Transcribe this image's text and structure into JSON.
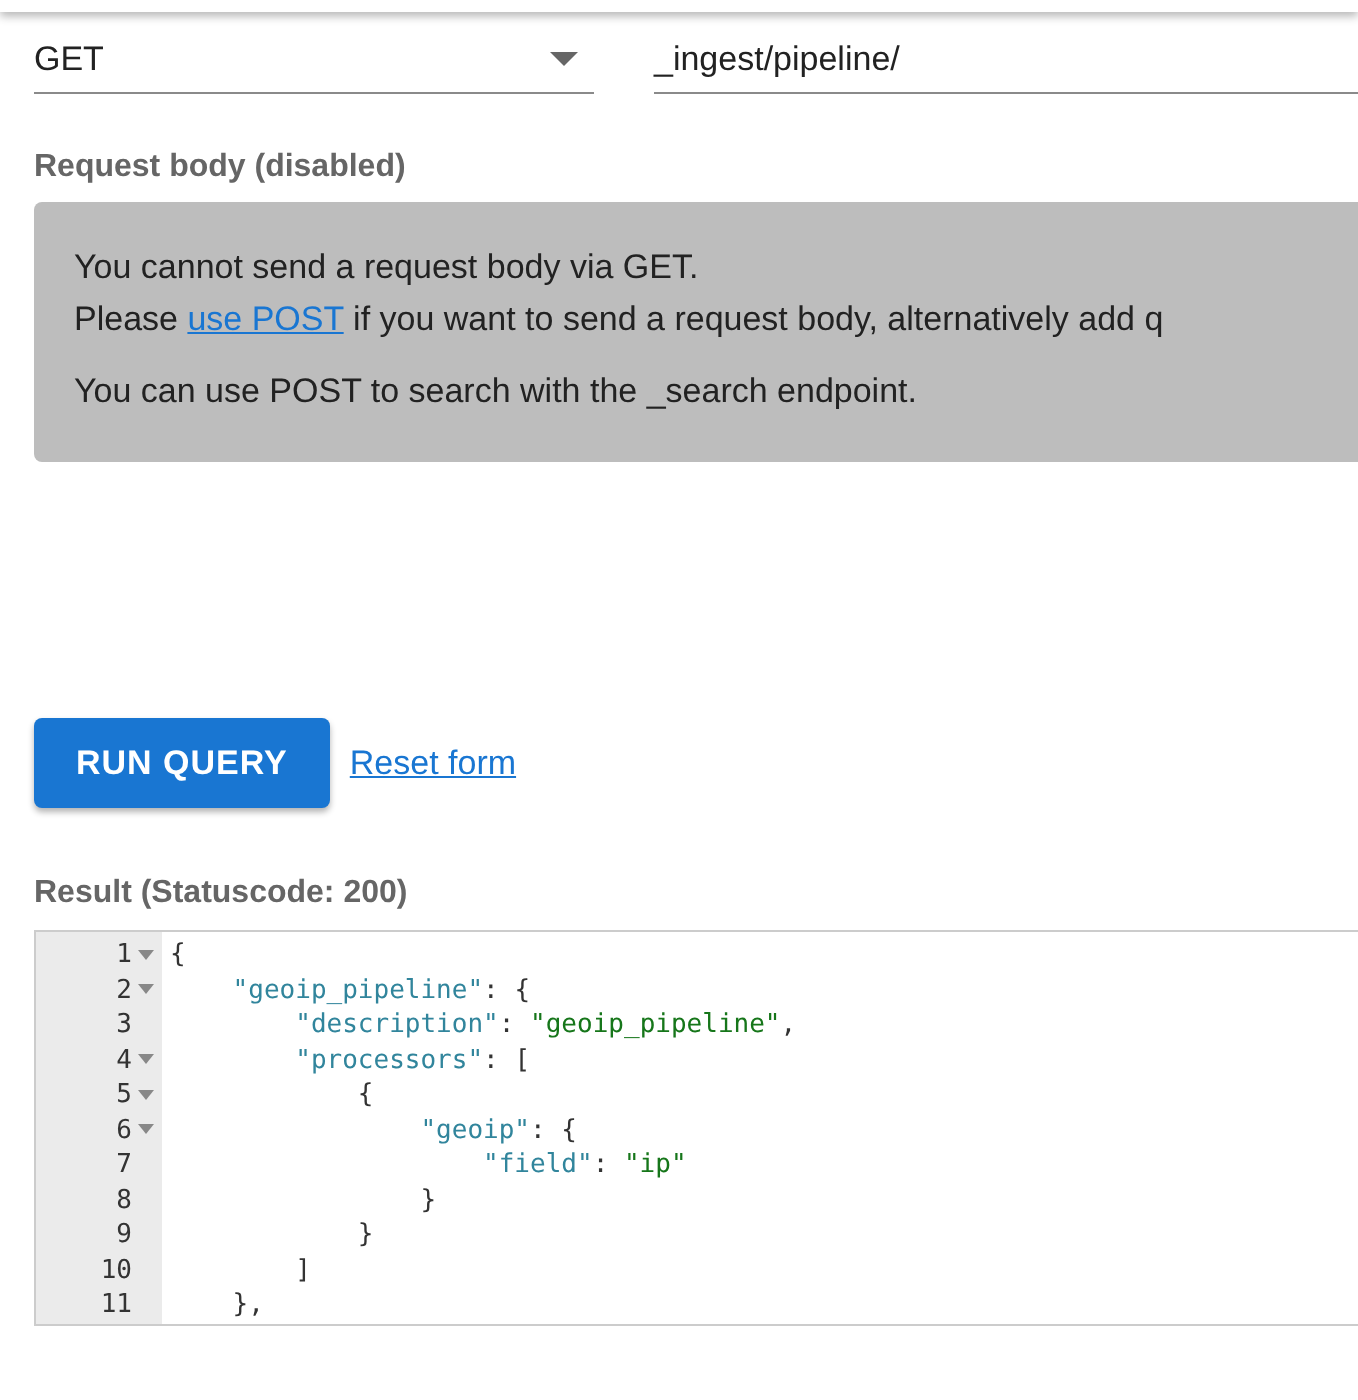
{
  "method_field": {
    "value": "GET"
  },
  "path_field": {
    "value": "_ingest/pipeline/"
  },
  "request_body": {
    "label": "Request body (disabled)",
    "disabled": true,
    "lines": [
      "You cannot send a request body via GET."
    ],
    "link_line": {
      "before": "Please ",
      "link": "use POST",
      "after": " if you want to send a request body, alternatively add q"
    },
    "note": "You can use POST to search with the _search endpoint."
  },
  "run_button": "RUN QUERY",
  "reset_link": "Reset form",
  "result": {
    "label": "Result (Statuscode: 200)",
    "lines": [
      {
        "number": "1",
        "foldable": true,
        "tokens": [
          {
            "kind": "bracket",
            "text": "{"
          }
        ]
      },
      {
        "number": "2",
        "foldable": true,
        "tokens": [
          {
            "kind": "key",
            "text": "    \"geoip_pipeline\""
          },
          {
            "kind": "punct",
            "text": ": {"
          }
        ]
      },
      {
        "number": "3",
        "foldable": false,
        "tokens": [
          {
            "kind": "key",
            "text": "        \"description\""
          },
          {
            "kind": "punct",
            "text": ": "
          },
          {
            "kind": "string",
            "text": "\"geoip_pipeline\""
          },
          {
            "kind": "punct",
            "text": ","
          }
        ]
      },
      {
        "number": "4",
        "foldable": true,
        "tokens": [
          {
            "kind": "key",
            "text": "        \"processors\""
          },
          {
            "kind": "punct",
            "text": ": ["
          }
        ]
      },
      {
        "number": "5",
        "foldable": true,
        "tokens": [
          {
            "kind": "punct",
            "text": "            {"
          }
        ]
      },
      {
        "number": "6",
        "foldable": true,
        "tokens": [
          {
            "kind": "key",
            "text": "                \"geoip\""
          },
          {
            "kind": "punct",
            "text": ": {"
          }
        ]
      },
      {
        "number": "7",
        "foldable": false,
        "tokens": [
          {
            "kind": "key",
            "text": "                    \"field\""
          },
          {
            "kind": "punct",
            "text": ": "
          },
          {
            "kind": "string",
            "text": "\"ip\""
          }
        ]
      },
      {
        "number": "8",
        "foldable": false,
        "tokens": [
          {
            "kind": "punct",
            "text": "                }"
          }
        ]
      },
      {
        "number": "9",
        "foldable": false,
        "tokens": [
          {
            "kind": "punct",
            "text": "            }"
          }
        ]
      },
      {
        "number": "10",
        "foldable": false,
        "tokens": [
          {
            "kind": "punct",
            "text": "        ]"
          }
        ]
      },
      {
        "number": "11",
        "foldable": false,
        "tokens": [
          {
            "kind": "punct",
            "text": "    },"
          }
        ]
      }
    ]
  }
}
